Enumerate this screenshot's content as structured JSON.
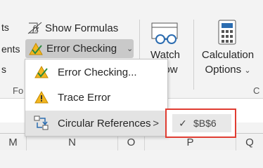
{
  "ribbon": {
    "left_cut_labels": [
      "ts",
      "ents",
      "s",
      "Fo"
    ],
    "show_formulas": {
      "label": "Show Formulas",
      "icon": "fx-icon"
    },
    "error_checking": {
      "label": "Error Checking",
      "icon": "warning-check-icon"
    },
    "watch_window": {
      "line1": "Watch",
      "line2": "ow",
      "icon": "glasses-icon"
    },
    "calculation_options": {
      "line1": "Calculation",
      "line2": "Options",
      "icon": "calculator-icon"
    },
    "right_cut_label": "C"
  },
  "menu": {
    "items": [
      {
        "label": "Error Checking...",
        "icon": "warning-check-icon"
      },
      {
        "label": "Trace Error",
        "icon": "warning-triangle-icon"
      },
      {
        "label": "Circular References",
        "icon": "circular-reference-icon"
      }
    ]
  },
  "submenu": {
    "check": "✓",
    "reference": "$B$6"
  },
  "columns": [
    "M",
    "N",
    "O",
    "P",
    "Q"
  ],
  "colors": {
    "highlight_border": "#e03c31",
    "accent": "#2b6cb0",
    "warning": "#f2b61f"
  }
}
